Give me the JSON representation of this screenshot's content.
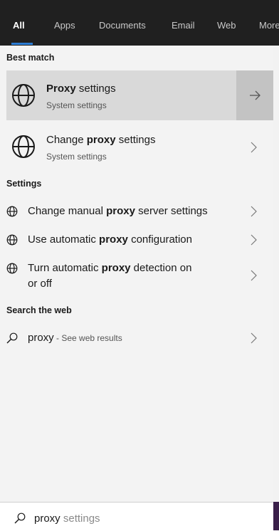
{
  "tabs": [
    "All",
    "Apps",
    "Documents",
    "Email",
    "Web",
    "More"
  ],
  "sections": {
    "best_match": "Best match",
    "settings": "Settings",
    "search_web": "Search the web"
  },
  "best_match": {
    "title_bold": "Proxy",
    "title_rest": " settings",
    "subtitle": "System settings",
    "icon": "globe-icon",
    "action_icon": "arrow-right-icon"
  },
  "change_proxy": {
    "title_pre": "Change ",
    "title_bold": "proxy",
    "title_post": " settings",
    "subtitle": "System settings",
    "icon": "globe-icon"
  },
  "settings_items": [
    {
      "pre": "Change manual ",
      "bold": "proxy",
      "post": " server settings"
    },
    {
      "pre": "Use automatic ",
      "bold": "proxy",
      "post": " configuration"
    },
    {
      "pre": "Turn automatic ",
      "bold": "proxy",
      "post": " detection on",
      "line2": "or off"
    }
  ],
  "web_result": {
    "query": "proxy",
    "hint": " - See web results",
    "icon": "search-icon"
  },
  "search": {
    "typed": "proxy",
    "suggestion": " settings",
    "icon": "search-icon"
  },
  "colors": {
    "tabbar": "#202020",
    "accent": "#2b7cd3",
    "selected_row": "#d9d9d9",
    "selected_action": "#c3c3c3"
  }
}
